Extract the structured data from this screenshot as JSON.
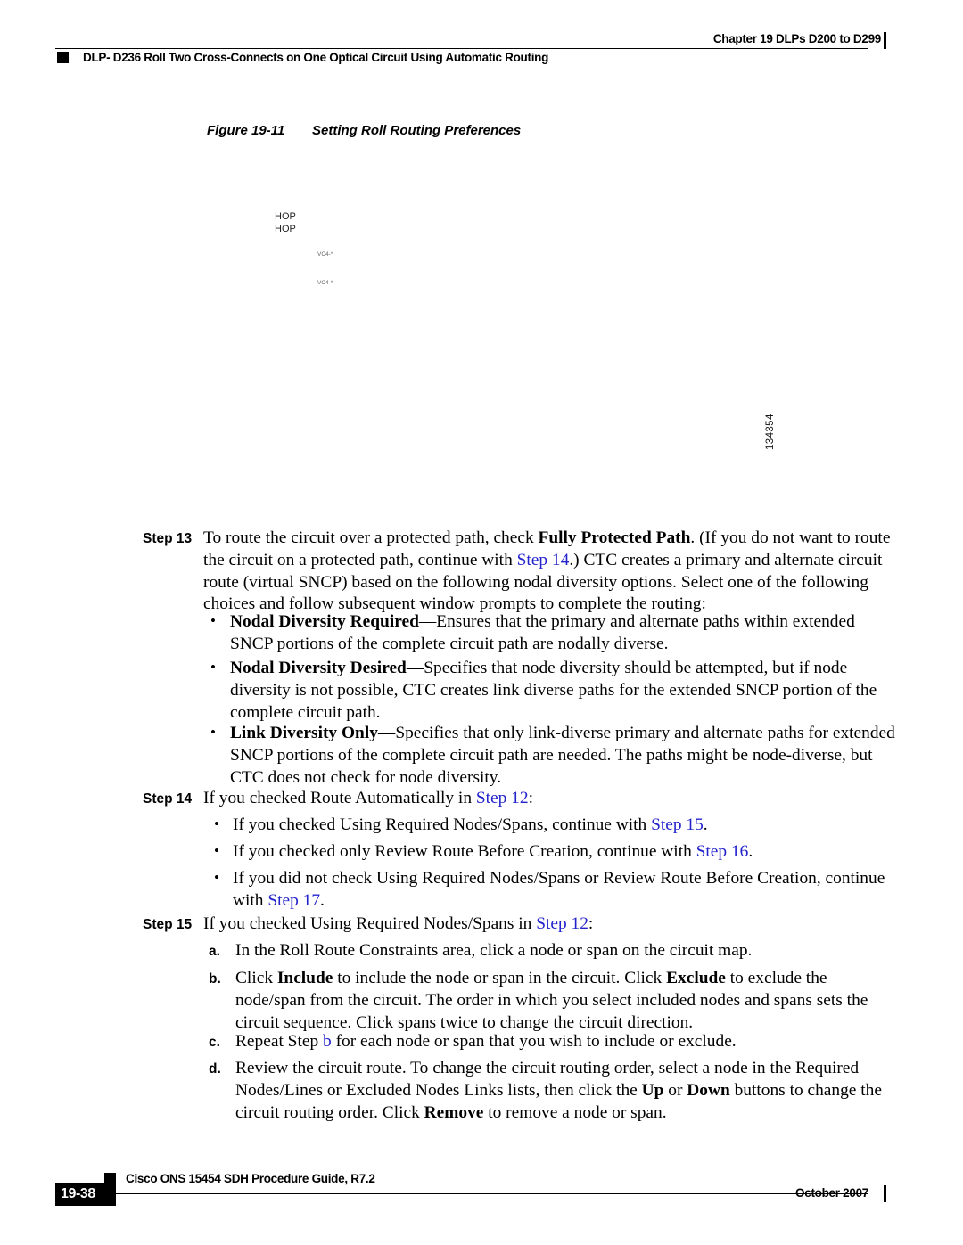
{
  "header": {
    "chapter": "Chapter 19 DLPs D200 to D299",
    "title": "DLP- D236 Roll Two Cross-Connects on One Optical Circuit Using Automatic Routing"
  },
  "figure": {
    "number": "Figure 19-11",
    "title": "Setting Roll Routing Preferences",
    "labels": {
      "hop_1": "HOP",
      "hop_2": "HOP",
      "vc4_1": "VC4-*",
      "vc4_2": "VC4-*"
    },
    "graphic_id": "134354"
  },
  "link_color": "#2323cc",
  "steps": [
    {
      "label": "Step 13",
      "text_1": "To route the circuit over a protected path, check ",
      "bold_1": "Fully Protected Path",
      "text_2": ". (If you do not want to route the circuit on a protected path, continue with ",
      "xref_1": "Step 14",
      "text_3": ".) CTC creates a primary and alternate circuit route (virtual SNCP) based on the following nodal diversity options. Select one of the following choices and follow subsequent window prompts to complete the routing:",
      "bullets": [
        {
          "bold": "Nodal Diversity Required",
          "text": "—Ensures that the primary and alternate paths within extended SNCP portions of the complete circuit path are nodally diverse."
        },
        {
          "bold": "Nodal Diversity Desired",
          "text": "—Specifies that node diversity should be attempted, but if node diversity is not possible, CTC creates link diverse paths for the extended SNCP portion of the complete circuit path."
        },
        {
          "bold": "Link Diversity Only",
          "text": "—Specifies that only link-diverse primary and alternate paths for extended SNCP portions of the complete circuit path are needed. The paths might be node-diverse, but CTC does not check for node diversity."
        }
      ]
    },
    {
      "label": "Step 14",
      "text_1": "If you checked Route Automatically in ",
      "xref_1": "Step 12",
      "text_2": ":",
      "bullets": [
        {
          "text_1": "If you checked Using Required Nodes/Spans, continue with ",
          "xref": "Step 15",
          "text_2": "."
        },
        {
          "text_1": "If you checked only Review Route Before Creation, continue with ",
          "xref": "Step 16",
          "text_2": "."
        },
        {
          "text_1": "If you did not check Using Required Nodes/Spans or Review Route Before Creation, continue with ",
          "xref": "Step 17",
          "text_2": "."
        }
      ]
    },
    {
      "label": "Step 15",
      "text_1": "If you checked Using Required Nodes/Spans in ",
      "xref_1": "Step 12",
      "text_2": ":",
      "alpha_items": [
        {
          "marker": "a.",
          "text_1": "In the Roll Route Constraints area, click a node or span on the circuit map."
        },
        {
          "marker": "b.",
          "text_1": "Click ",
          "bold_1": "Include",
          "text_2": " to include the node or span in the circuit. Click ",
          "bold_2": "Exclude",
          "text_3": " to exclude the node/span from the circuit. The order in which you select included nodes and spans sets the circuit sequence. Click spans twice to change the circuit direction."
        },
        {
          "marker": "c.",
          "text_1": "Repeat Step ",
          "xref_1": "b",
          "text_2": " for each node or span that you wish to include or exclude."
        },
        {
          "marker": "d.",
          "text_1": "Review the circuit route. To change the circuit routing order, select a node in the Required Nodes/Lines or Excluded Nodes Links lists, then click the ",
          "bold_1": "Up",
          "text_2": " or ",
          "bold_2": "Down",
          "text_3": " buttons to change the circuit routing order. Click ",
          "bold_3": "Remove",
          "text_4": " to remove a node or span."
        }
      ]
    }
  ],
  "footer": {
    "guide": "Cisco ONS 15454 SDH Procedure Guide, R7.2",
    "page_number": "19-38",
    "date": "October 2007"
  }
}
